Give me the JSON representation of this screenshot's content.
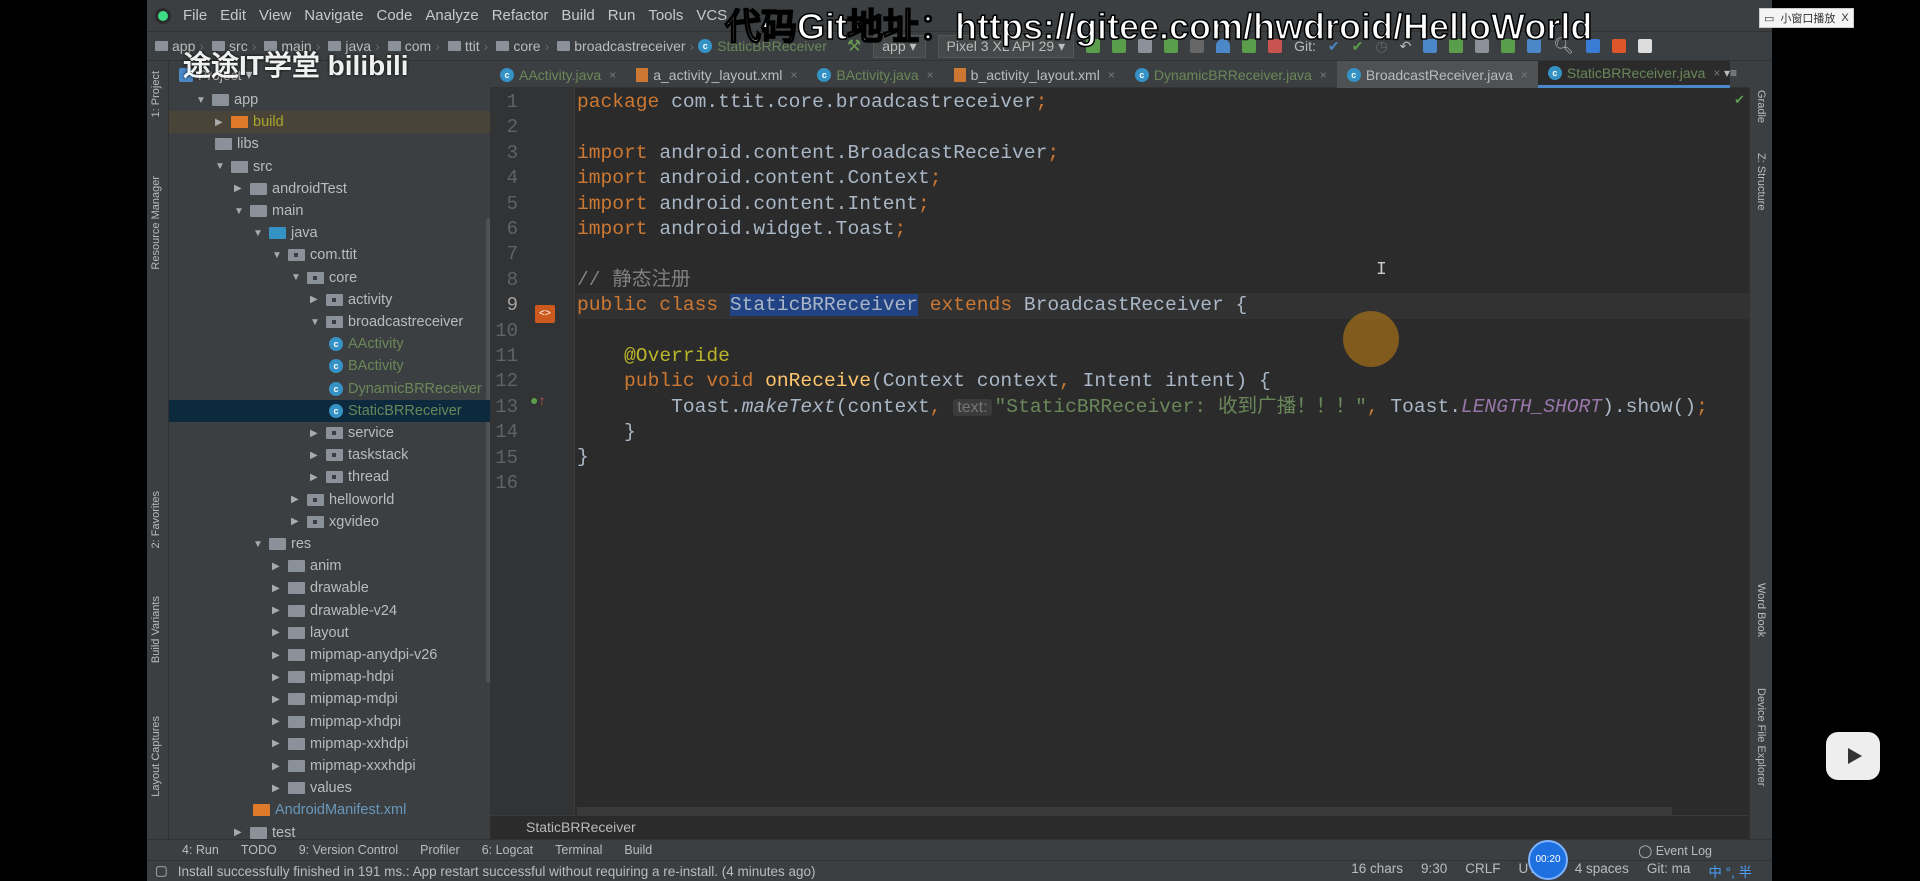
{
  "menu": [
    "File",
    "Edit",
    "View",
    "Navigate",
    "Code",
    "Analyze",
    "Refactor",
    "Build",
    "Run",
    "Tools",
    "VCS"
  ],
  "breadcrumb": [
    "app",
    "src",
    "main",
    "java",
    "com",
    "ttit",
    "core",
    "broadcastreceiver",
    "StaticBRReceiver"
  ],
  "toolbar": {
    "run_config": "app",
    "device": "Pixel 3 XL API 29",
    "git_label": "Git:"
  },
  "project_panel": {
    "title": "Project"
  },
  "tabs": [
    {
      "label": "AActivity.java",
      "type": "class"
    },
    {
      "label": "a_activity_layout.xml",
      "type": "xml"
    },
    {
      "label": "BActivity.java",
      "type": "class"
    },
    {
      "label": "b_activity_layout.xml",
      "type": "xml"
    },
    {
      "label": "DynamicBRReceiver.java",
      "type": "class"
    },
    {
      "label": "BroadcastReceiver.java",
      "type": "class",
      "state": "active"
    },
    {
      "label": "StaticBRReceiver.java",
      "type": "class",
      "state": "selected"
    }
  ],
  "tree": [
    {
      "level": 0,
      "arrow": "down",
      "label": "app",
      "icon": "module"
    },
    {
      "level": 1,
      "arrow": "right",
      "label": "build",
      "icon": "orange",
      "style": "olive",
      "highlight": true
    },
    {
      "level": 1,
      "arrow": "",
      "label": "libs",
      "icon": "folder"
    },
    {
      "level": 1,
      "arrow": "down",
      "label": "src",
      "icon": "folder"
    },
    {
      "level": 2,
      "arrow": "right",
      "label": "androidTest",
      "icon": "folder"
    },
    {
      "level": 2,
      "arrow": "down",
      "label": "main",
      "icon": "folder"
    },
    {
      "level": 3,
      "arrow": "down",
      "label": "java",
      "icon": "blue"
    },
    {
      "level": 4,
      "arrow": "down",
      "label": "com.ttit",
      "icon": "pkg"
    },
    {
      "level": 5,
      "arrow": "down",
      "label": "core",
      "icon": "pkg"
    },
    {
      "level": 6,
      "arrow": "right",
      "label": "activity",
      "icon": "pkg"
    },
    {
      "level": 6,
      "arrow": "down",
      "label": "broadcastreceiver",
      "icon": "pkg"
    },
    {
      "level": 7,
      "arrow": "",
      "label": "AActivity",
      "icon": "class",
      "style": "green"
    },
    {
      "level": 7,
      "arrow": "",
      "label": "BActivity",
      "icon": "class",
      "style": "green"
    },
    {
      "level": 7,
      "arrow": "",
      "label": "DynamicBRReceiver",
      "icon": "class",
      "style": "green"
    },
    {
      "level": 7,
      "arrow": "",
      "label": "StaticBRReceiver",
      "icon": "class",
      "style": "green",
      "selected": true
    },
    {
      "level": 6,
      "arrow": "right",
      "label": "service",
      "icon": "pkg"
    },
    {
      "level": 6,
      "arrow": "right",
      "label": "taskstack",
      "icon": "pkg"
    },
    {
      "level": 6,
      "arrow": "right",
      "label": "thread",
      "icon": "pkg"
    },
    {
      "level": 5,
      "arrow": "right",
      "label": "helloworld",
      "icon": "pkg"
    },
    {
      "level": 5,
      "arrow": "right",
      "label": "xgvideo",
      "icon": "pkg"
    },
    {
      "level": 3,
      "arrow": "down",
      "label": "res",
      "icon": "folder"
    },
    {
      "level": 4,
      "arrow": "right",
      "label": "anim",
      "icon": "folder"
    },
    {
      "level": 4,
      "arrow": "right",
      "label": "drawable",
      "icon": "folder"
    },
    {
      "level": 4,
      "arrow": "right",
      "label": "drawable-v24",
      "icon": "folder"
    },
    {
      "level": 4,
      "arrow": "right",
      "label": "layout",
      "icon": "folder"
    },
    {
      "level": 4,
      "arrow": "right",
      "label": "mipmap-anydpi-v26",
      "icon": "folder"
    },
    {
      "level": 4,
      "arrow": "right",
      "label": "mipmap-hdpi",
      "icon": "folder"
    },
    {
      "level": 4,
      "arrow": "right",
      "label": "mipmap-mdpi",
      "icon": "folder"
    },
    {
      "level": 4,
      "arrow": "right",
      "label": "mipmap-xhdpi",
      "icon": "folder"
    },
    {
      "level": 4,
      "arrow": "right",
      "label": "mipmap-xxhdpi",
      "icon": "folder"
    },
    {
      "level": 4,
      "arrow": "right",
      "label": "mipmap-xxxhdpi",
      "icon": "folder"
    },
    {
      "level": 4,
      "arrow": "right",
      "label": "values",
      "icon": "folder"
    },
    {
      "level": 3,
      "arrow": "",
      "label": "AndroidManifest.xml",
      "icon": "manifest",
      "style": "blue"
    },
    {
      "level": 2,
      "arrow": "right",
      "label": "test",
      "icon": "folder"
    }
  ],
  "code": {
    "current_line": 9,
    "lines": [
      [
        [
          "kw",
          "package "
        ],
        [
          "",
          "com.ttit.core.broadcastreceiver"
        ],
        [
          "kw",
          ";"
        ]
      ],
      [],
      [
        [
          "kw",
          "import "
        ],
        [
          "",
          "android.content.BroadcastReceiver"
        ],
        [
          "kw",
          ";"
        ]
      ],
      [
        [
          "kw",
          "import "
        ],
        [
          "",
          "android.content.Context"
        ],
        [
          "kw",
          ";"
        ]
      ],
      [
        [
          "kw",
          "import "
        ],
        [
          "",
          "android.content.Intent"
        ],
        [
          "kw",
          ";"
        ]
      ],
      [
        [
          "kw",
          "import "
        ],
        [
          "",
          "android.widget.Toast"
        ],
        [
          "kw",
          ";"
        ]
      ],
      [],
      [
        [
          "com",
          "// 静态注册"
        ]
      ],
      [
        [
          "kw",
          "public class "
        ],
        [
          "sl",
          "StaticBRReceiver"
        ],
        [
          "",
          " "
        ],
        [
          "kw",
          "extends "
        ],
        [
          "",
          "BroadcastReceiver {"
        ]
      ],
      [],
      [
        [
          "",
          "    "
        ],
        [
          "ann",
          "@Override"
        ]
      ],
      [
        [
          "",
          "    "
        ],
        [
          "kw",
          "public void "
        ],
        [
          "mth",
          "onReceive"
        ],
        [
          "",
          "(Context context"
        ],
        [
          "kw",
          ", "
        ],
        [
          "",
          "Intent intent) {"
        ]
      ],
      [
        [
          "",
          "        Toast."
        ],
        [
          "it",
          "makeText"
        ],
        [
          "",
          "(context"
        ],
        [
          "kw",
          ", "
        ],
        [
          "hint",
          "text:"
        ],
        [
          "str",
          "\"StaticBRReceiver: 收到广播！！！\""
        ],
        [
          "kw",
          ", "
        ],
        [
          "",
          "Toast."
        ],
        [
          "sf",
          "LENGTH_SHORT"
        ],
        [
          "",
          ").show()"
        ],
        [
          "kw",
          ";"
        ]
      ],
      [
        [
          "",
          "    }"
        ]
      ],
      [
        [
          "",
          "}"
        ]
      ],
      []
    ]
  },
  "editor_breadcrumb": "StaticBRReceiver",
  "left_strip": [
    "1: Project",
    "Resource Manager",
    "2: Favorites",
    "Build Variants",
    "Layout Captures"
  ],
  "right_strip": [
    "Gradle",
    "Z: Structure",
    "Word Book",
    "Device File Explorer"
  ],
  "tool_windows": [
    "4: Run",
    "TODO",
    "9: Version Control",
    "Profiler",
    "6: Logcat",
    "Terminal",
    "Build"
  ],
  "event_log": "Event Log",
  "status": {
    "message": "Install successfully finished in 191 ms.: App restart successful without requiring a re-install. (4 minutes ago)",
    "chars": "16 chars",
    "position": "9:30",
    "line_sep": "CRLF",
    "encoding": "UTF-8",
    "indent": "4 spaces",
    "git": "Git: ma"
  },
  "overlay": {
    "watermark": "途途IT学堂 bilibili",
    "git_caption": "代码Git地址：https://gitee.com/hwdroid/HelloWorld",
    "pip_button": "小窗口播放",
    "pip_close": "X",
    "timer": "00:20"
  },
  "colors": {
    "keyword": "#cc7832",
    "string": "#6a8759",
    "annotation": "#bbb529",
    "method": "#ffc66d",
    "selection": "#214283",
    "accent": "#4a88c7"
  }
}
